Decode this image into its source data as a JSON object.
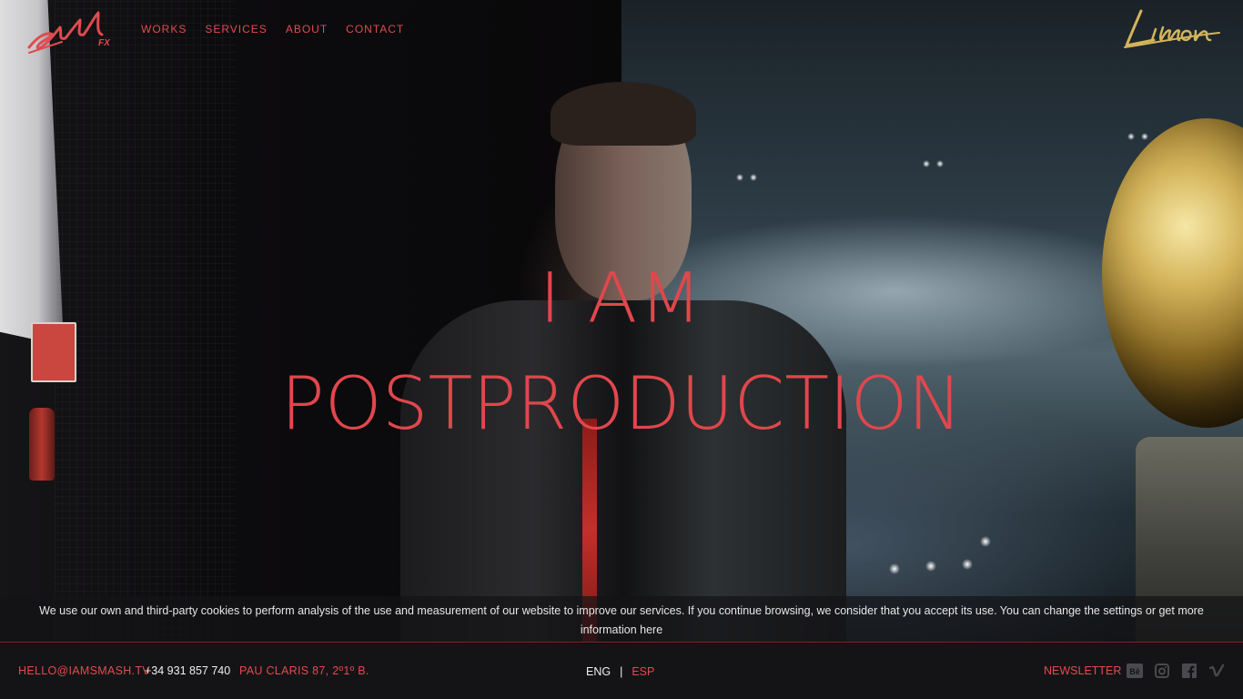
{
  "brand": {
    "logo_text": "Smash",
    "logo_sub": "FX",
    "partner_logo_text": "Limon"
  },
  "nav": {
    "items": [
      {
        "label": "WORKS"
      },
      {
        "label": "SERVICES"
      },
      {
        "label": "ABOUT"
      },
      {
        "label": "CONTACT"
      }
    ]
  },
  "hero": {
    "line1": "I AM",
    "line2": "POSTPRODUCTION"
  },
  "cookie": {
    "message": "We use our own and third-party cookies to perform analysis of the use and measurement of our website to improve our services. If you continue browsing, we consider that you accept its use. You can change the settings or ",
    "link_text": "get more information here"
  },
  "footer": {
    "email": "HELLO@IAMSMASH.TV",
    "phone": "+34 931 857 740",
    "address": "PAU CLARIS 87, 2º1º B.",
    "lang_eng": "ENG",
    "lang_sep": "|",
    "lang_esp": "ESP",
    "newsletter": "NEWSLETTER",
    "social": [
      {
        "icon": "behance-icon",
        "glyph": "Bē"
      },
      {
        "icon": "instagram-icon",
        "glyph": ""
      },
      {
        "icon": "facebook-icon",
        "glyph": "f"
      },
      {
        "icon": "vimeo-icon",
        "glyph": "v"
      }
    ]
  },
  "colors": {
    "accent": "#e04b4f",
    "partner_gold": "#d4b45a",
    "footer_bg": "#141416"
  }
}
